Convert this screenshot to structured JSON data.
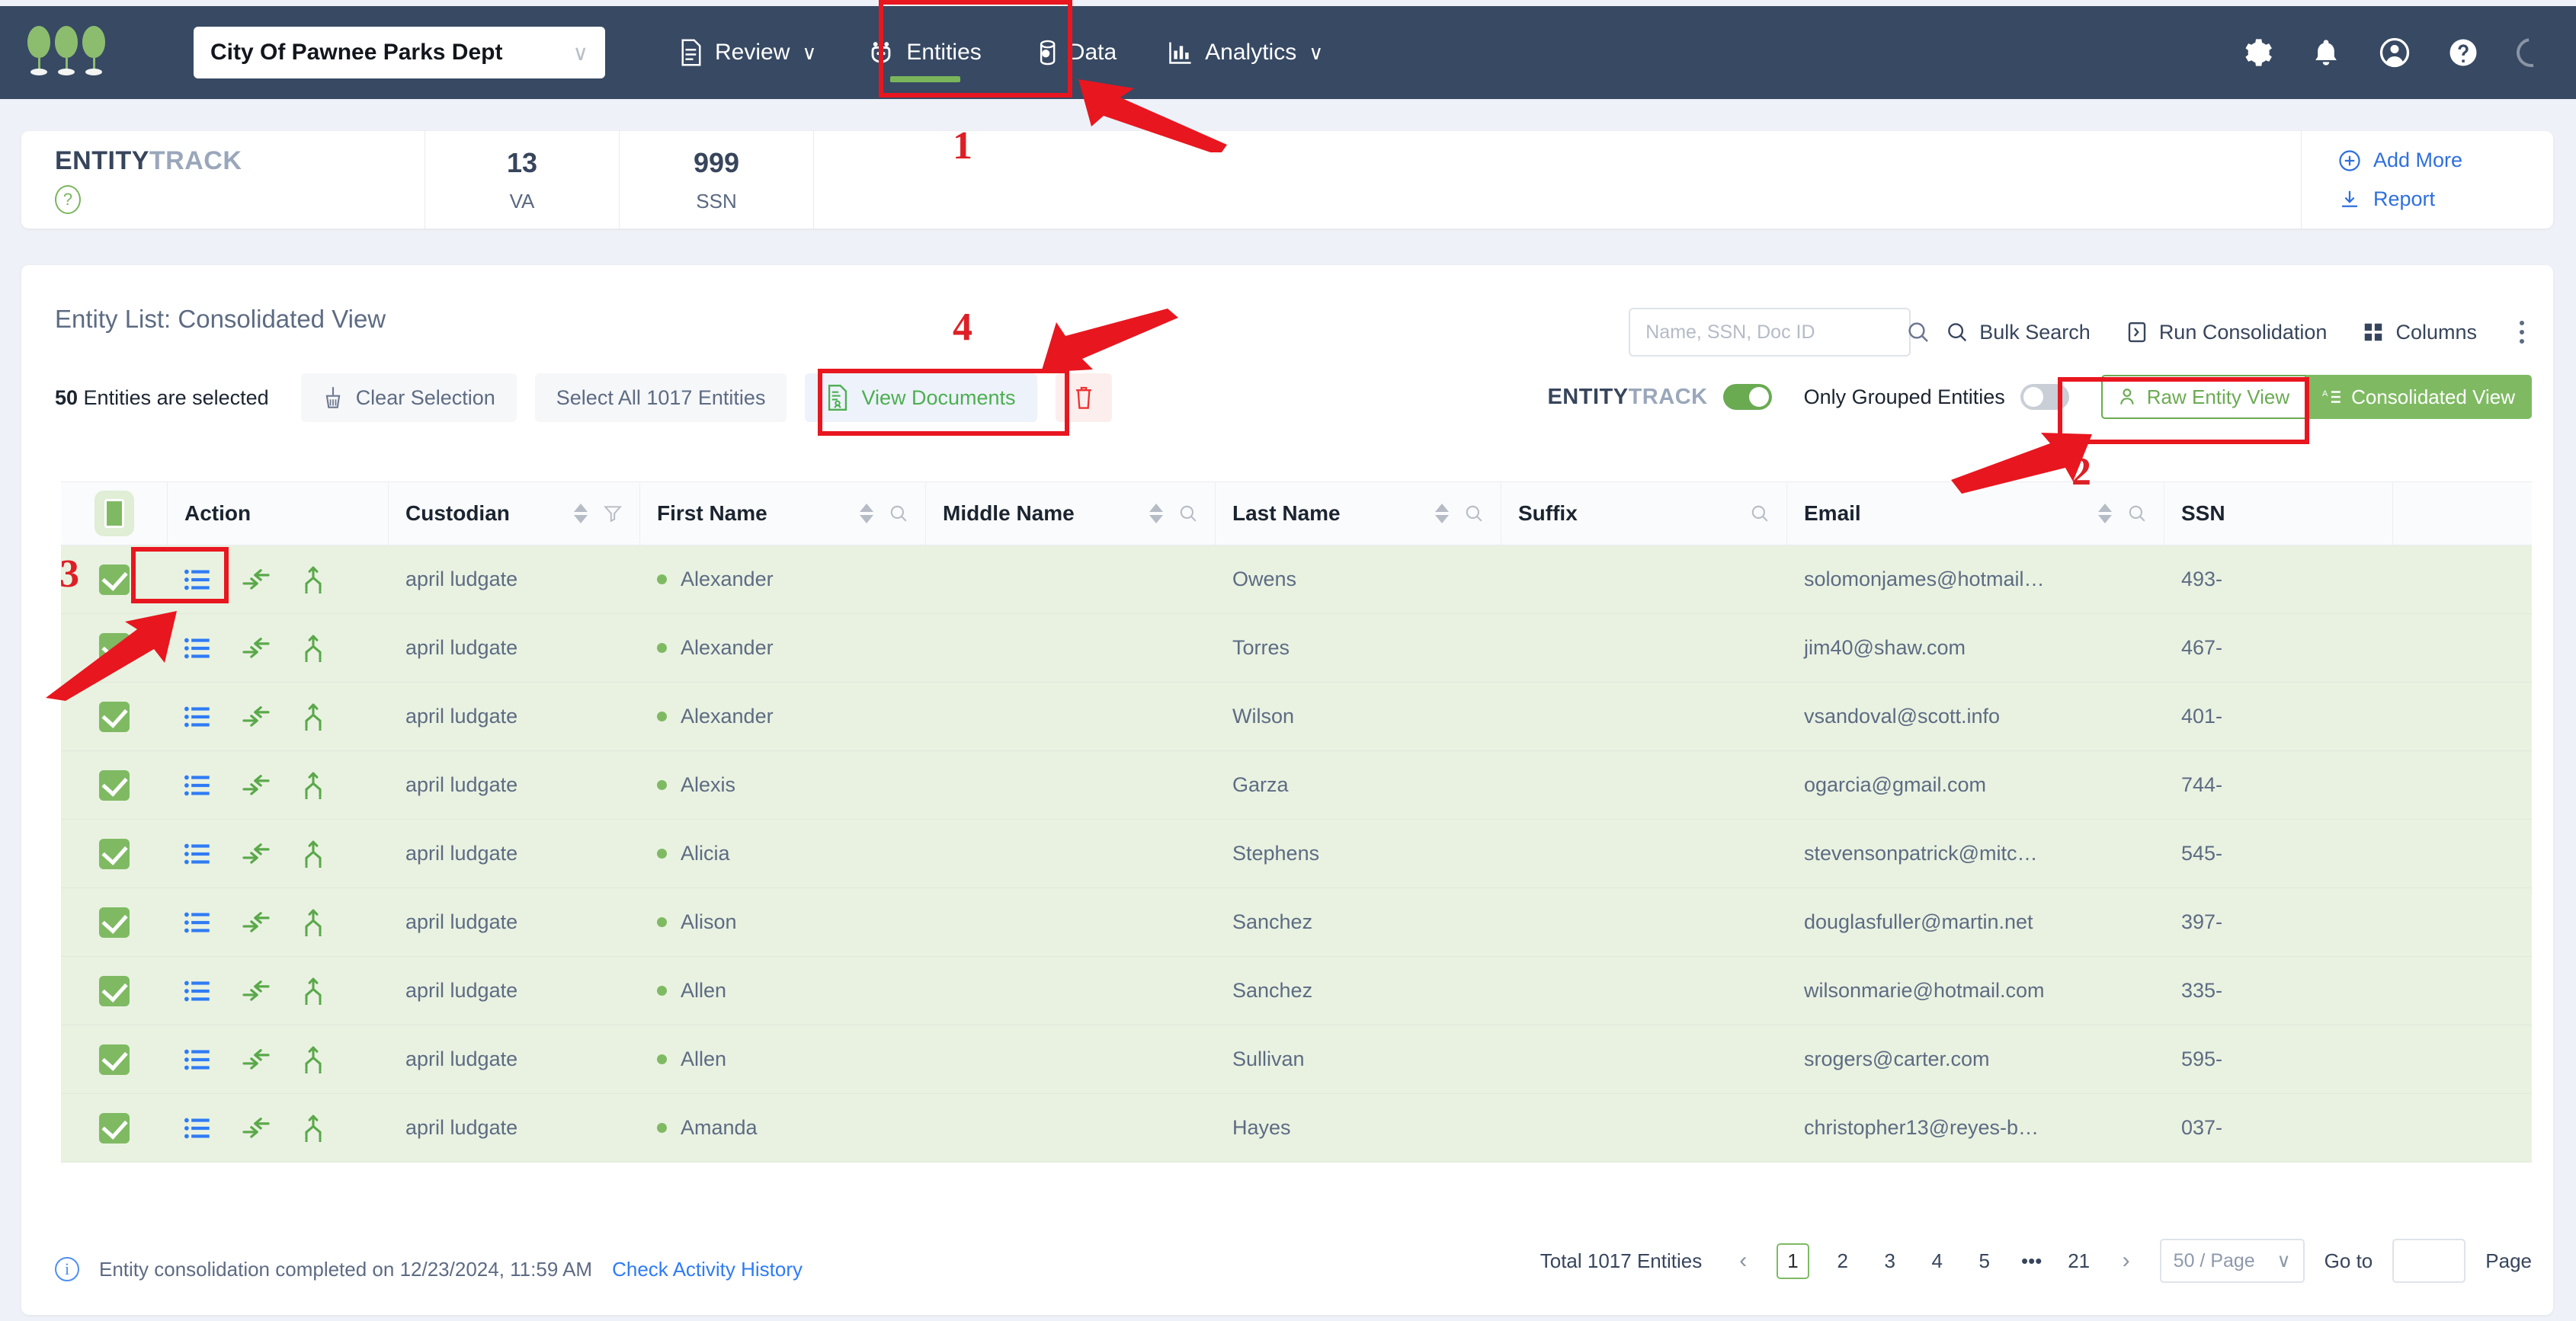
{
  "topnav": {
    "logo_name": "three-trees-logo",
    "org_selector": {
      "value": "City Of Pawnee Parks Dept",
      "chevron": "∨"
    },
    "items": [
      {
        "label": "Review",
        "icon": "document-icon",
        "has_caret": true,
        "active": false
      },
      {
        "label": "Entities",
        "icon": "entities-group-icon",
        "has_caret": false,
        "active": true
      },
      {
        "label": "Data",
        "icon": "database-icon",
        "has_caret": false,
        "active": false
      },
      {
        "label": "Analytics",
        "icon": "bar-chart-icon",
        "has_caret": true,
        "active": false
      }
    ],
    "right_icons": [
      "gear-icon",
      "bell-icon",
      "user-account-icon",
      "help-icon",
      "loading-spinner-icon"
    ],
    "bg_color": "#374963"
  },
  "stats": {
    "brand_primary": "ENTITY",
    "brand_secondary": "TRACK",
    "help_glyph": "?",
    "cells": [
      {
        "value": "13",
        "label": "VA"
      },
      {
        "value": "999",
        "label": "SSN"
      }
    ],
    "actions": [
      {
        "label": "Add More",
        "icon": "plus-circle-icon"
      },
      {
        "label": "Report",
        "icon": "download-icon"
      }
    ],
    "link_color": "#2f6fdd"
  },
  "toolbar": {
    "title": "Entity List: Consolidated View",
    "selection_count_bold": "50",
    "selection_count_rest": " Entities are selected",
    "clear_selection": "Clear Selection",
    "select_all": "Select All 1017 Entities",
    "view_documents": "View Documents",
    "delete_icon": "trash-icon",
    "search_placeholder": "Name, SSN, Doc ID",
    "search_value": "",
    "bulk_search": "Bulk Search",
    "run_consolidation": "Run Consolidation",
    "columns": "Columns",
    "kebab": "more-options-icon",
    "entitytrack_toggle_label_primary": "ENTITY",
    "entitytrack_toggle_label_secondary": "TRACK",
    "entitytrack_toggle_on": true,
    "only_grouped_label": "Only Grouped Entities",
    "only_grouped_on": false,
    "raw_entity_view": "Raw Entity View",
    "consolidated_view": "Consolidated View",
    "accent_green": "#7fba63"
  },
  "table": {
    "columns": [
      {
        "key": "check",
        "label": "",
        "sortable": false,
        "searchable": false,
        "filterable": false
      },
      {
        "key": "action",
        "label": "Action",
        "sortable": false,
        "searchable": false,
        "filterable": false
      },
      {
        "key": "custodian",
        "label": "Custodian",
        "sortable": true,
        "searchable": false,
        "filterable": true
      },
      {
        "key": "first",
        "label": "First Name",
        "sortable": true,
        "searchable": true,
        "filterable": false
      },
      {
        "key": "middle",
        "label": "Middle Name",
        "sortable": true,
        "searchable": true,
        "filterable": false
      },
      {
        "key": "last",
        "label": "Last Name",
        "sortable": true,
        "searchable": true,
        "filterable": false
      },
      {
        "key": "suffix",
        "label": "Suffix",
        "sortable": false,
        "searchable": true,
        "filterable": false
      },
      {
        "key": "email",
        "label": "Email",
        "sortable": true,
        "searchable": true,
        "filterable": false
      },
      {
        "key": "ssn",
        "label": "SSN",
        "sortable": false,
        "searchable": false,
        "filterable": false
      }
    ],
    "row_action_icons": [
      "list-details-icon",
      "merge-arrows-icon",
      "split-branch-icon"
    ],
    "rows": [
      {
        "checked": true,
        "custodian": "april ludgate",
        "first": "Alexander",
        "middle": "",
        "last": "Owens",
        "suffix": "",
        "email": "solomonjames@hotmail…",
        "ssn": "493-"
      },
      {
        "checked": true,
        "custodian": "april ludgate",
        "first": "Alexander",
        "middle": "",
        "last": "Torres",
        "suffix": "",
        "email": "jim40@shaw.com",
        "ssn": "467-"
      },
      {
        "checked": true,
        "custodian": "april ludgate",
        "first": "Alexander",
        "middle": "",
        "last": "Wilson",
        "suffix": "",
        "email": "vsandoval@scott.info",
        "ssn": "401-"
      },
      {
        "checked": true,
        "custodian": "april ludgate",
        "first": "Alexis",
        "middle": "",
        "last": "Garza",
        "suffix": "",
        "email": "ogarcia@gmail.com",
        "ssn": "744-"
      },
      {
        "checked": true,
        "custodian": "april ludgate",
        "first": "Alicia",
        "middle": "",
        "last": "Stephens",
        "suffix": "",
        "email": "stevensonpatrick@mitc…",
        "ssn": "545-"
      },
      {
        "checked": true,
        "custodian": "april ludgate",
        "first": "Alison",
        "middle": "",
        "last": "Sanchez",
        "suffix": "",
        "email": "douglasfuller@martin.net",
        "ssn": "397-"
      },
      {
        "checked": true,
        "custodian": "april ludgate",
        "first": "Allen",
        "middle": "",
        "last": "Sanchez",
        "suffix": "",
        "email": "wilsonmarie@hotmail.com",
        "ssn": "335-"
      },
      {
        "checked": true,
        "custodian": "april ludgate",
        "first": "Allen",
        "middle": "",
        "last": "Sullivan",
        "suffix": "",
        "email": "srogers@carter.com",
        "ssn": "595-"
      },
      {
        "checked": true,
        "custodian": "april ludgate",
        "first": "Amanda",
        "middle": "",
        "last": "Hayes",
        "suffix": "",
        "email": "christopher13@reyes-b…",
        "ssn": "037-"
      }
    ]
  },
  "footer": {
    "status_text": "Entity consolidation completed on 12/23/2024, 11:59 AM",
    "activity_link": "Check Activity History",
    "total_text": "Total 1017 Entities",
    "prev": "‹",
    "next": "›",
    "pages": [
      "1",
      "2",
      "3",
      "4",
      "5",
      "•••",
      "21"
    ],
    "active_page": "1",
    "page_size": "50 / Page",
    "goto_label": "Go to",
    "goto_value": "",
    "page_label": "Page"
  },
  "annotations": {
    "color": "#e8161f",
    "markers": [
      {
        "number": "1",
        "target": "entities-tab"
      },
      {
        "number": "2",
        "target": "raw-entity-view-button"
      },
      {
        "number": "3",
        "target": "row-checkbox"
      },
      {
        "number": "4",
        "target": "view-documents-button"
      }
    ]
  }
}
